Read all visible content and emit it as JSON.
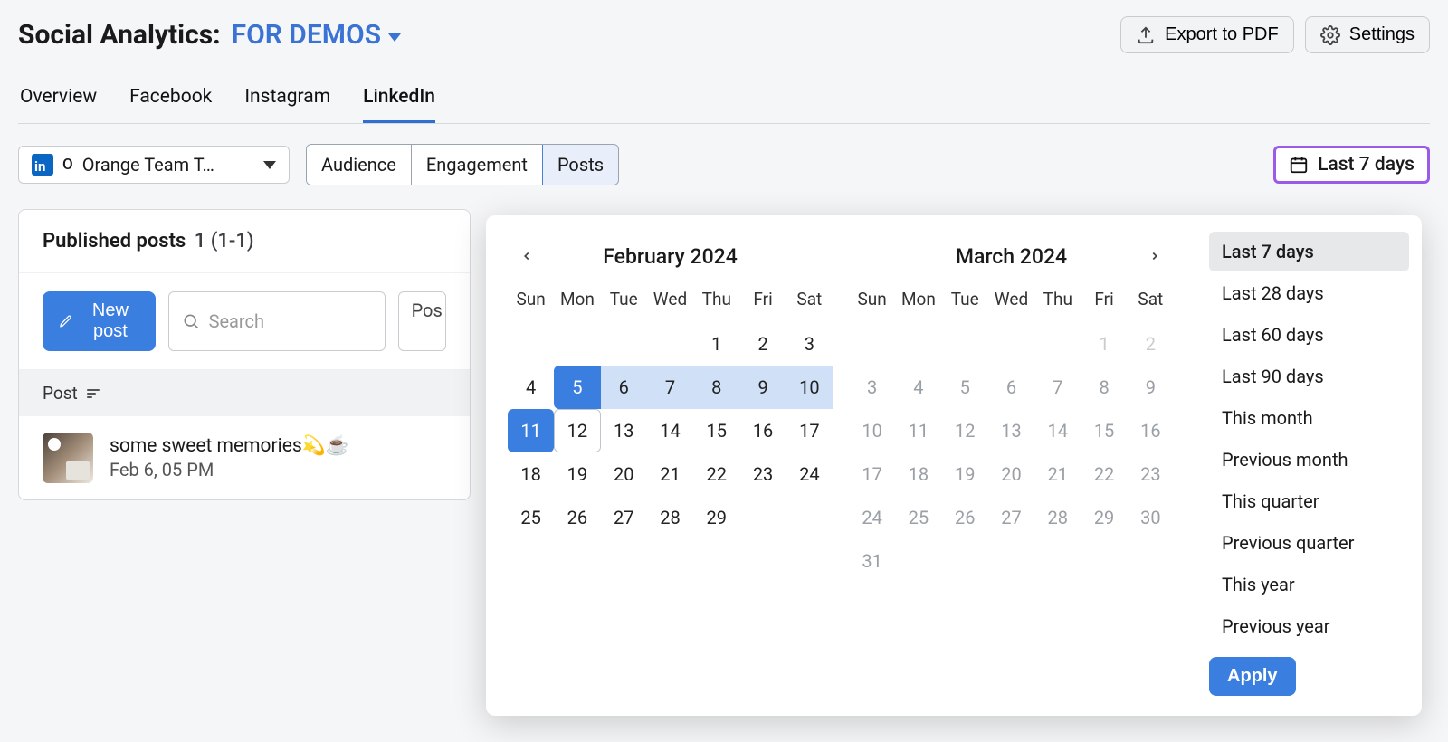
{
  "header": {
    "title": "Social Analytics:",
    "project": "FOR DEMOS",
    "export_label": "Export to PDF",
    "settings_label": "Settings"
  },
  "tabs": [
    "Overview",
    "Facebook",
    "Instagram",
    "LinkedIn"
  ],
  "active_tab_index": 3,
  "account_selector": {
    "network_icon": "linkedin",
    "network_badge_text": "O",
    "label": "Orange Team T…"
  },
  "segments": [
    "Audience",
    "Engagement",
    "Posts"
  ],
  "active_segment_index": 2,
  "date_range_button": "Last 7 days",
  "published": {
    "heading": "Published posts",
    "count_suffix": "1 (1-1)",
    "new_post_label": "New post",
    "search_placeholder": "Search",
    "dropdown_cut": "Pos",
    "column_label": "Post"
  },
  "posts": [
    {
      "title": "some sweet memories💫☕",
      "date": "Feb 6, 05 PM"
    }
  ],
  "datepicker": {
    "months": [
      {
        "title": "February 2024",
        "dow": [
          "Sun",
          "Mon",
          "Tue",
          "Wed",
          "Thu",
          "Fri",
          "Sat"
        ],
        "leading_blanks": 4,
        "days": 29,
        "range_start": 5,
        "range_end": 11,
        "today": 12
      },
      {
        "title": "March 2024",
        "dow": [
          "Sun",
          "Mon",
          "Tue",
          "Wed",
          "Thu",
          "Fri",
          "Sat"
        ],
        "leading_blanks": 5,
        "days": 31,
        "muted_lead_days": [
          1,
          2
        ]
      }
    ],
    "presets": [
      "Last 7 days",
      "Last 28 days",
      "Last 60 days",
      "Last 90 days",
      "This month",
      "Previous month",
      "This quarter",
      "Previous quarter",
      "This year",
      "Previous year"
    ],
    "active_preset_index": 0,
    "apply_label": "Apply"
  }
}
